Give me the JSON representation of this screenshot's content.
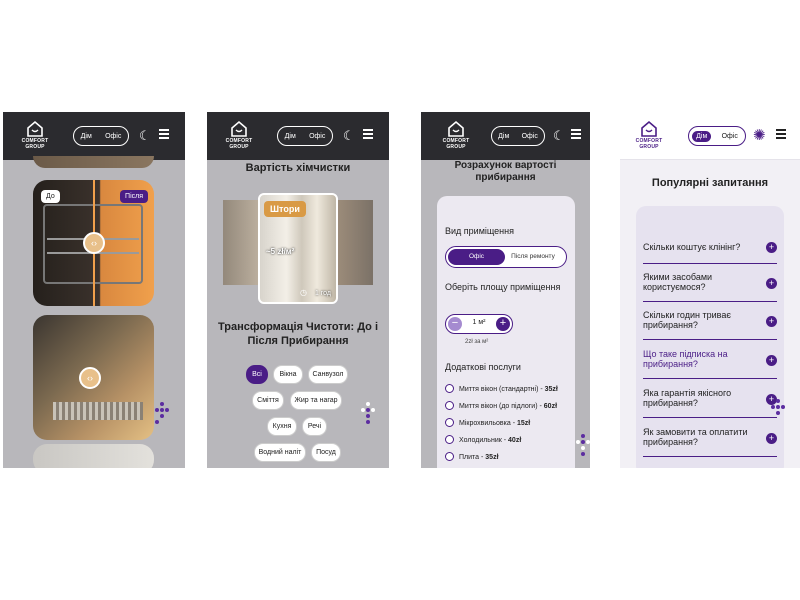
{
  "common": {
    "logo_text_1": "COMFORT",
    "logo_text_2": "GROUP",
    "seg_home": "Дім",
    "seg_office": "Офіс",
    "moon_icon": "moon-icon",
    "menu_icon": "hamburger-icon",
    "sun_icon": "sun-icon",
    "brand_color": "#4a1d86"
  },
  "screen1": {
    "tag_before": "До",
    "tag_after": "Після",
    "handle_glyph": "‹›"
  },
  "screen2": {
    "title": "Вартість хімчистки",
    "service_name": "Штори",
    "price": "~5 zł/м²",
    "duration": "1 год",
    "section_title": "Трансформація Чистоти: До і Після Прибирання",
    "chips": [
      "Всі",
      "Вікна",
      "Санвузол",
      "Сміття",
      "Жир та нагар",
      "Кухня",
      "Речі",
      "Водний наліт",
      "Посуд"
    ]
  },
  "screen3": {
    "title": "Розрахунок вартості прибирання",
    "room_type_label": "Вид приміщення",
    "room_opt_office": "Офіс",
    "room_opt_repair": "Після ремонту",
    "area_label": "Оберіть площу приміщення",
    "area_value": "1 м²",
    "area_price": "2zł за м²",
    "extra_label": "Додаткові послуги",
    "services": [
      {
        "name": "Миття вікон (стандартні)",
        "price": "35zł"
      },
      {
        "name": "Миття вікон (до підлоги)",
        "price": "60zł"
      },
      {
        "name": "Мікрохвильовка",
        "price": "15zł"
      },
      {
        "name": "Холодильник",
        "price": "40zł"
      },
      {
        "name": "Плита",
        "price": "35zł"
      }
    ]
  },
  "screen4": {
    "title": "Популярні запитання",
    "faqs": [
      "Скільки коштує клінінг?",
      "Якими засобами користуємося?",
      "Скільки годин триває прибирання?",
      "Що таке підписка на прибирання?",
      "Яка гарантія якісного прибирання?",
      "Як замовити та оплатити прибирання?"
    ]
  }
}
